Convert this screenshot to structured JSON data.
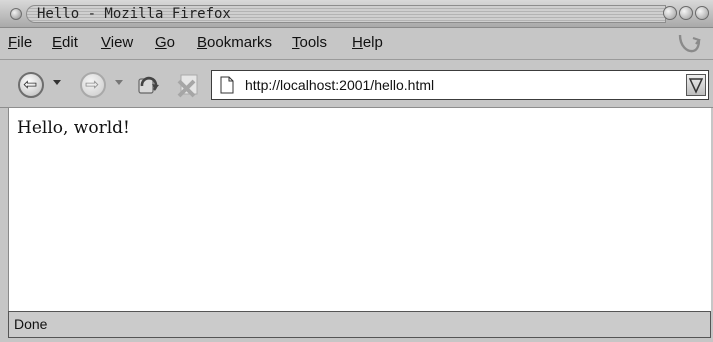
{
  "window": {
    "title": "Hello - Mozilla Firefox"
  },
  "menu": {
    "items": [
      {
        "label": "File",
        "mnemonic": "F"
      },
      {
        "label": "Edit",
        "mnemonic": "E"
      },
      {
        "label": "View",
        "mnemonic": "V"
      },
      {
        "label": "Go",
        "mnemonic": "G"
      },
      {
        "label": "Bookmarks",
        "mnemonic": "B"
      },
      {
        "label": "Tools",
        "mnemonic": "T"
      },
      {
        "label": "Help",
        "mnemonic": "H"
      }
    ]
  },
  "toolbar": {
    "back_icon": "left-arrow-icon",
    "forward_icon": "right-arrow-icon",
    "reload_icon": "reload-icon",
    "stop_icon": "stop-icon"
  },
  "address": {
    "url": "http://localhost:2001/hello.html"
  },
  "page": {
    "text": "Hello, world!"
  },
  "status": {
    "text": "Done"
  }
}
